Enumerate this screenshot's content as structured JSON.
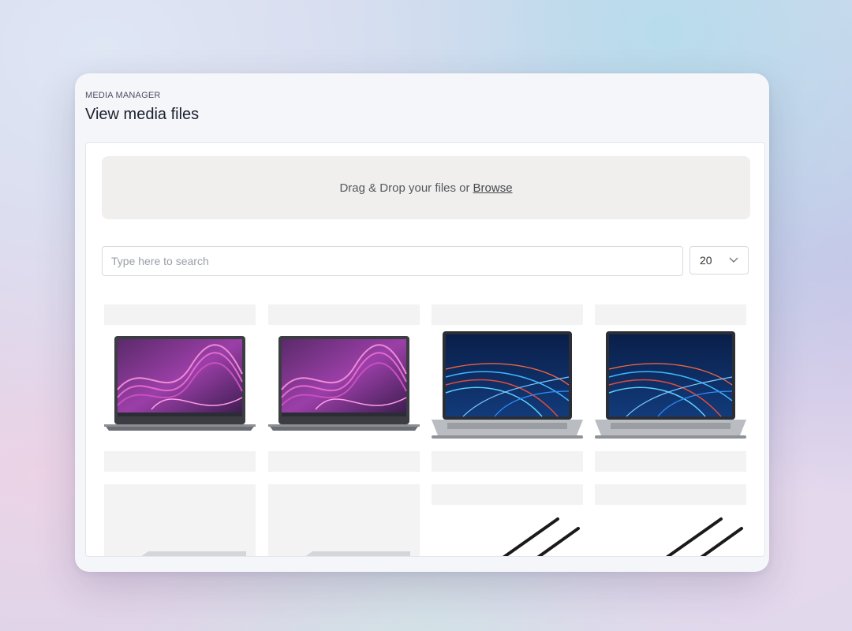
{
  "header": {
    "eyebrow": "MEDIA MANAGER",
    "title": "View media files"
  },
  "dropzone": {
    "text": "Drag & Drop your files or",
    "browse_label": "Browse"
  },
  "search": {
    "placeholder": "Type here to search",
    "value": ""
  },
  "per_page": {
    "selected": "20"
  },
  "media_items": [
    {
      "image": "laptop-dark-purple-wave-screen"
    },
    {
      "image": "laptop-dark-purple-wave-screen"
    },
    {
      "image": "laptop-silver-blue-lights-screen"
    },
    {
      "image": "laptop-silver-blue-lights-screen"
    },
    {
      "image": "laptop-closed-silver"
    },
    {
      "image": "laptop-closed-silver"
    },
    {
      "image": "black-cable"
    },
    {
      "image": "black-cable"
    }
  ],
  "colors": {
    "window_bg": "#f5f6fa",
    "dropzone_bg": "#f0efed",
    "placeholder_bar": "#f3f3f3",
    "title_text": "#1c2130"
  }
}
